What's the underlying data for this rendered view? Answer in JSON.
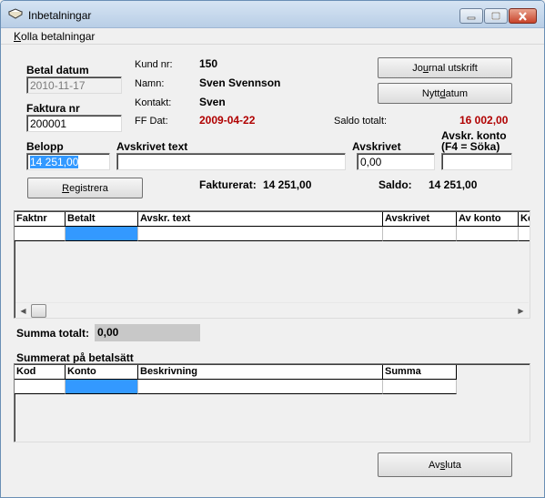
{
  "window": {
    "title": "Inbetalningar",
    "min_icon": "minimize-icon",
    "max_icon": "maximize-icon",
    "close_icon": "close-icon"
  },
  "menu": {
    "item_prefix": "K",
    "item_rest": "olla betalningar"
  },
  "form": {
    "betal_datum_label": "Betal datum",
    "betal_datum_value": "2010-11-17",
    "faktura_nr_label": "Faktura nr",
    "faktura_nr_value": "200001",
    "kund_nr_label": "Kund nr:",
    "kund_nr_value": "150",
    "namn_label": "Namn:",
    "namn_value": "Sven Svennson",
    "kontakt_label": "Kontakt:",
    "kontakt_value": "Sven",
    "ff_dat_label": "FF Dat:",
    "ff_dat_value": "2009-04-22",
    "saldo_totalt_label": "Saldo totalt:",
    "saldo_totalt_value": "16 002,00",
    "belopp_label": "Belopp",
    "belopp_value": "14 251,00",
    "avskrivet_text_label": "Avskrivet text",
    "avskrivet_text_value": "",
    "avskrivet_label": "Avskrivet",
    "avskrivet_value": "0,00",
    "avskr_konto_label_1": "Avskr. konto",
    "avskr_konto_label_2": "(F4 = Söka)",
    "avskr_konto_value": "",
    "fakturerat_label": "Fakturerat:",
    "fakturerat_value": "14 251,00",
    "saldo_label": "Saldo:",
    "saldo_value": "14 251,00"
  },
  "buttons": {
    "journal_pre": "Jo",
    "journal_u": "u",
    "journal_post": "rnal utskrift",
    "nytt_pre": "Nytt ",
    "nytt_u": "d",
    "nytt_post": "atum",
    "registrera_u": "R",
    "registrera_post": "egistrera",
    "avsluta_pre": "Av",
    "avsluta_u": "s",
    "avsluta_post": "luta"
  },
  "payments_grid": {
    "columns": [
      "Faktnr",
      "Betalt",
      "Avskr. text",
      "Avskrivet",
      "Av konto",
      "Ko"
    ]
  },
  "summa": {
    "label": "Summa totalt:",
    "value": "0,00"
  },
  "summerat": {
    "label": "Summerat på betalsätt",
    "columns": [
      "Kod",
      "Konto",
      "Beskrivning",
      "Summa"
    ]
  },
  "colors": {
    "accent": "#3399ff",
    "amount_red": "#b00000"
  }
}
